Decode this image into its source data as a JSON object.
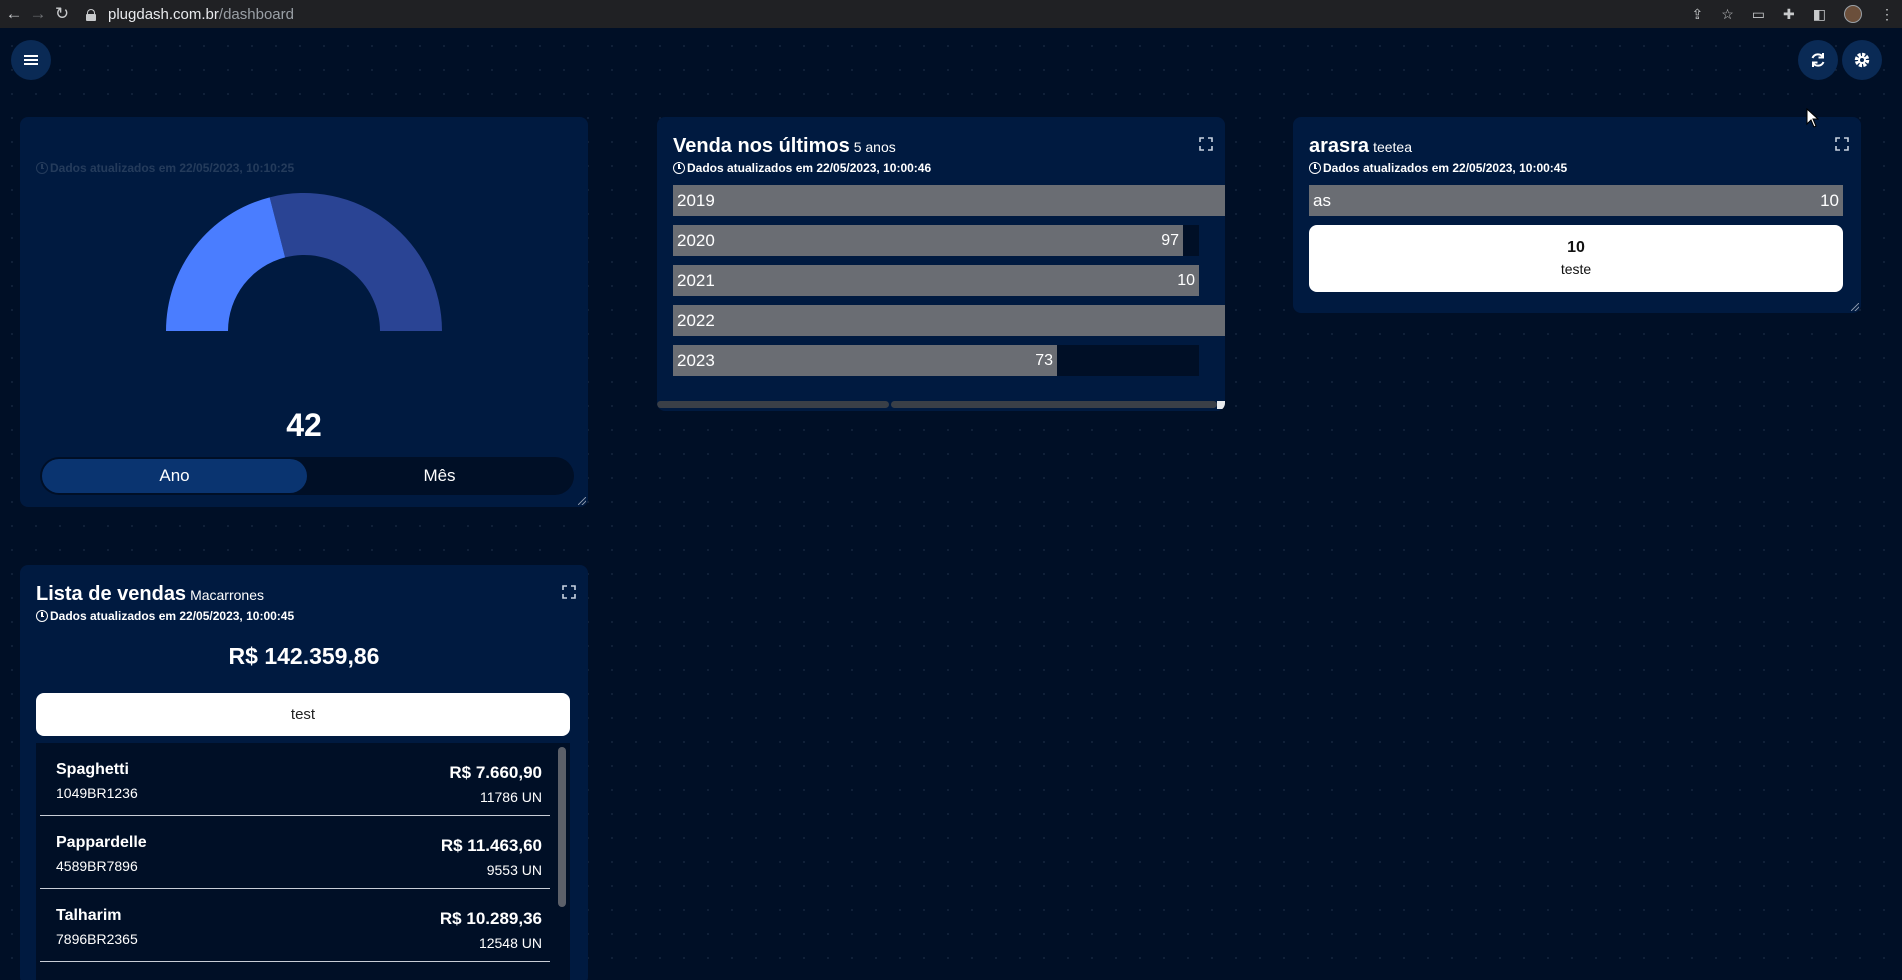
{
  "browser": {
    "url_host": "plugdash.com.br",
    "url_path": "/dashboard"
  },
  "gauge_card": {
    "updated": "Dados atualizados em 22/05/2023, 10:10:25",
    "value": "42",
    "gauge_fraction": 0.42,
    "colors": {
      "filled": "#4a7dff",
      "rest": "#2a4494"
    },
    "toggle": [
      {
        "label": "Ano",
        "active": true
      },
      {
        "label": "Mês",
        "active": false
      }
    ]
  },
  "bar_card": {
    "title": "Venda nos últimos",
    "subtitle": "5 anos",
    "updated": "Dados atualizados em 22/05/2023, 10:00:46"
  },
  "chart_data": {
    "type": "bar",
    "orientation": "horizontal",
    "categories": [
      "2019",
      "2020",
      "2021",
      "2022",
      "2023"
    ],
    "values": [
      110,
      97,
      100,
      105,
      73
    ],
    "value_labels": [
      "",
      "97",
      "10",
      "",
      "73"
    ],
    "xlim": [
      0,
      100
    ]
  },
  "tag_card": {
    "title": "arasra",
    "subtitle": "teetea",
    "updated": "Dados atualizados em 22/05/2023, 10:00:45",
    "bar": {
      "label": "as",
      "value": "10"
    },
    "stat": {
      "value": "10",
      "label": "teste"
    }
  },
  "sales_card": {
    "title": "Lista de vendas",
    "subtitle": "Macarrones",
    "updated": "Dados atualizados em 22/05/2023, 10:00:45",
    "total": "R$ 142.359,86",
    "filter_value": "test",
    "items": [
      {
        "name": "Spaghetti",
        "code": "1049BR1236",
        "price": "R$ 7.660,90",
        "qty": "11786 UN"
      },
      {
        "name": "Pappardelle",
        "code": "4589BR7896",
        "price": "R$ 11.463,60",
        "qty": "9553 UN"
      },
      {
        "name": "Talharim",
        "code": "7896BR2365",
        "price": "R$ 10.289,36",
        "qty": "12548 UN"
      }
    ]
  }
}
